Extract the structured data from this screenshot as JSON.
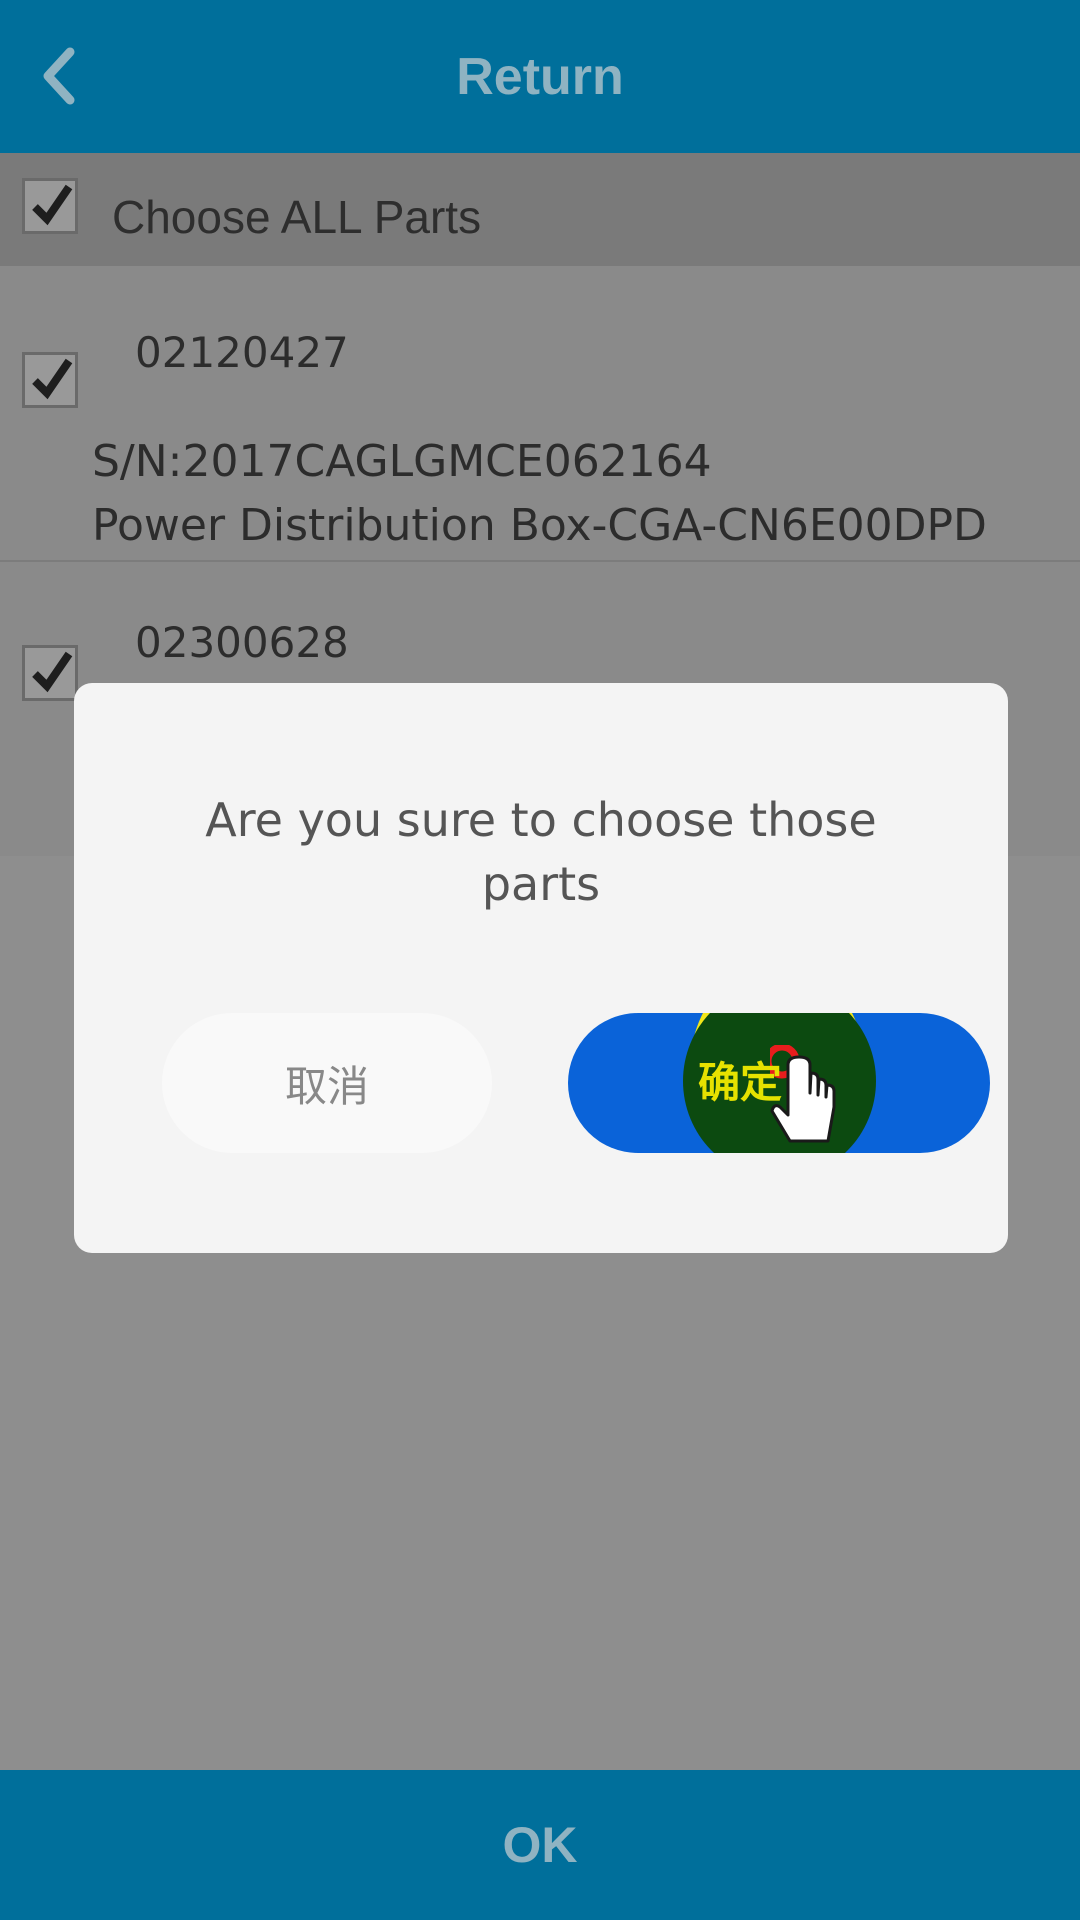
{
  "header": {
    "title": "Return",
    "back_icon": "chevron-left-icon"
  },
  "select_all": {
    "label": "Choose ALL Parts",
    "checked": true
  },
  "parts": [
    {
      "code": "02120427",
      "sn": "S/N:2017CAGLGMCE062164",
      "description": "Power Distribution Box-CGA-CN6E00DPD",
      "checked": true
    },
    {
      "code": "02300628",
      "sn": "",
      "description": "",
      "checked": true
    }
  ],
  "dialog": {
    "message": "Are you sure to choose those parts",
    "cancel_label": "取消",
    "confirm_label": "确定"
  },
  "footer": {
    "ok_label": "OK"
  },
  "colors": {
    "header_bg": "#006f9b",
    "confirm_bg": "#0a63d9",
    "highlight": "#f2e71a"
  }
}
